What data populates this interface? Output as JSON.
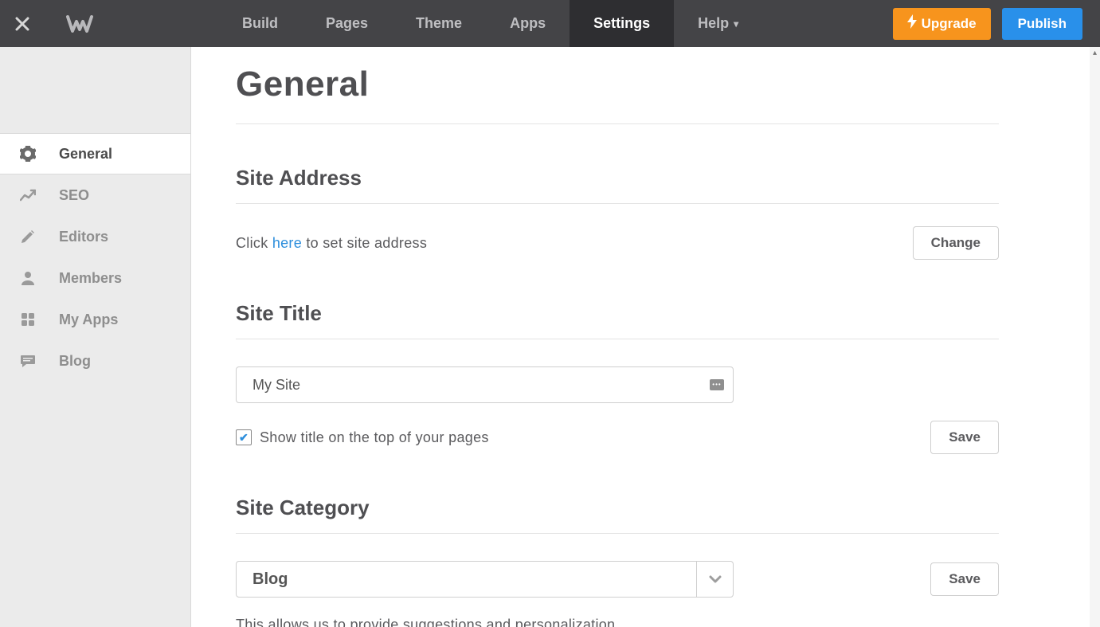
{
  "nav": {
    "items": [
      {
        "label": "Build"
      },
      {
        "label": "Pages"
      },
      {
        "label": "Theme"
      },
      {
        "label": "Apps"
      },
      {
        "label": "Settings",
        "active": true
      },
      {
        "label": "Help",
        "dropdown": true
      }
    ],
    "upgrade": "Upgrade",
    "publish": "Publish"
  },
  "sidebar": {
    "items": [
      {
        "label": "General",
        "icon": "gear",
        "active": true
      },
      {
        "label": "SEO",
        "icon": "trend"
      },
      {
        "label": "Editors",
        "icon": "pencil"
      },
      {
        "label": "Members",
        "icon": "person"
      },
      {
        "label": "My Apps",
        "icon": "grid"
      },
      {
        "label": "Blog",
        "icon": "comment"
      }
    ]
  },
  "page": {
    "title": "General",
    "site_address": {
      "heading": "Site Address",
      "text_before": "Click ",
      "link": "here",
      "text_after": " to set site address",
      "change": "Change"
    },
    "site_title": {
      "heading": "Site Title",
      "value": "My Site",
      "show_checkbox_label": "Show title on the top of your pages",
      "show_checked": true,
      "save": "Save"
    },
    "site_category": {
      "heading": "Site Category",
      "selected": "Blog",
      "save": "Save",
      "helper": "This allows us to provide suggestions and personalization."
    }
  }
}
